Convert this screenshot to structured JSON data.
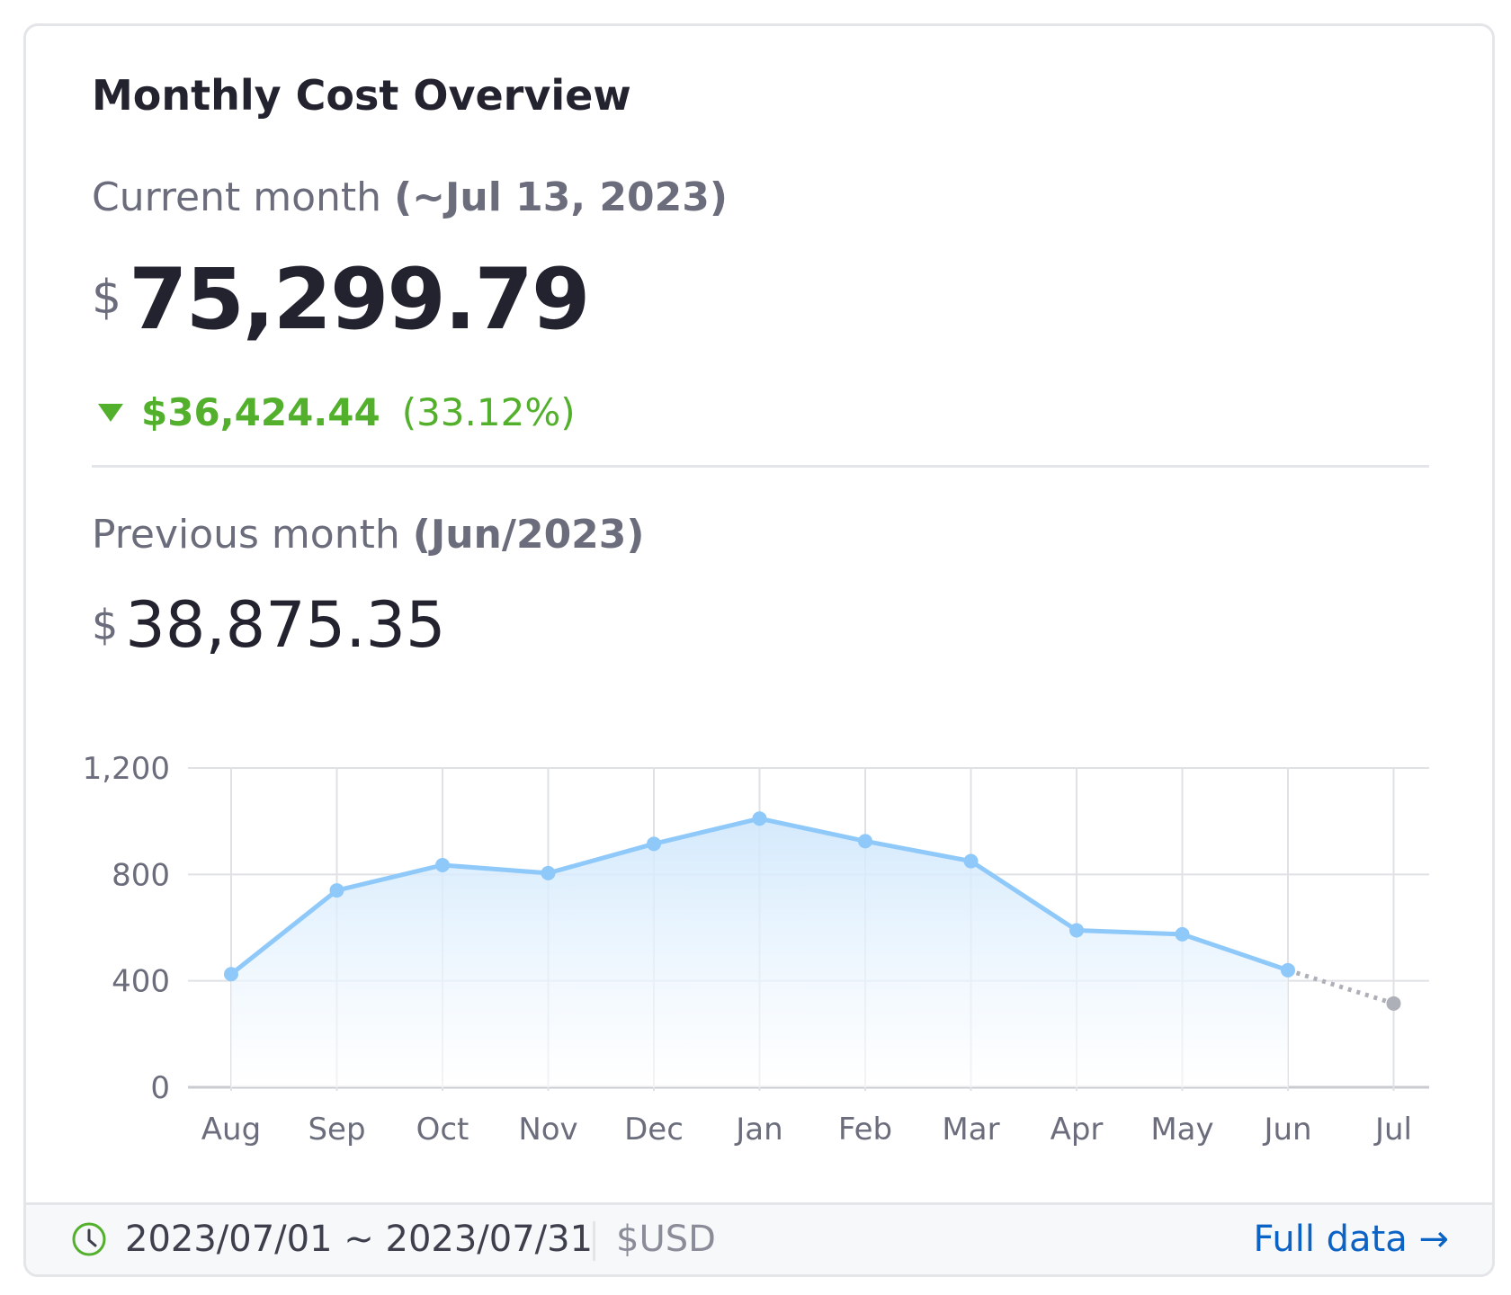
{
  "title": "Monthly Cost Overview",
  "current": {
    "label": "Current month",
    "period": "(~Jul 13, 2023)",
    "currency_symbol": "$",
    "amount": "75,299.79",
    "change_amount": "$36,424.44",
    "change_percent": "(33.12%)",
    "change_direction": "down"
  },
  "previous": {
    "label": "Previous month",
    "period": "(Jun/2023)",
    "currency_symbol": "$",
    "amount": "38,875.35"
  },
  "footer": {
    "date_range": "2023/07/01 ~ 2023/07/31",
    "currency": "$USD",
    "link_label": "Full data →",
    "icon": "clock-icon"
  },
  "colors": {
    "line": "#8ec9fa",
    "forecast": "#aeb0b8",
    "positive_change": "#52b02c",
    "link": "#0b63c5"
  },
  "chart_data": {
    "type": "area",
    "categories": [
      "Aug",
      "Sep",
      "Oct",
      "Nov",
      "Dec",
      "Jan",
      "Feb",
      "Mar",
      "Apr",
      "May",
      "Jun",
      "Jul"
    ],
    "values": [
      425,
      740,
      835,
      805,
      915,
      1010,
      925,
      850,
      590,
      575,
      440,
      315
    ],
    "forecast_from_index": 10,
    "ylim": [
      0,
      1200
    ],
    "yticks": [
      0,
      400,
      800,
      1200
    ],
    "ytick_labels": [
      "0",
      "400",
      "800",
      "1,200"
    ],
    "grid": true,
    "xlabel": "",
    "ylabel": ""
  }
}
